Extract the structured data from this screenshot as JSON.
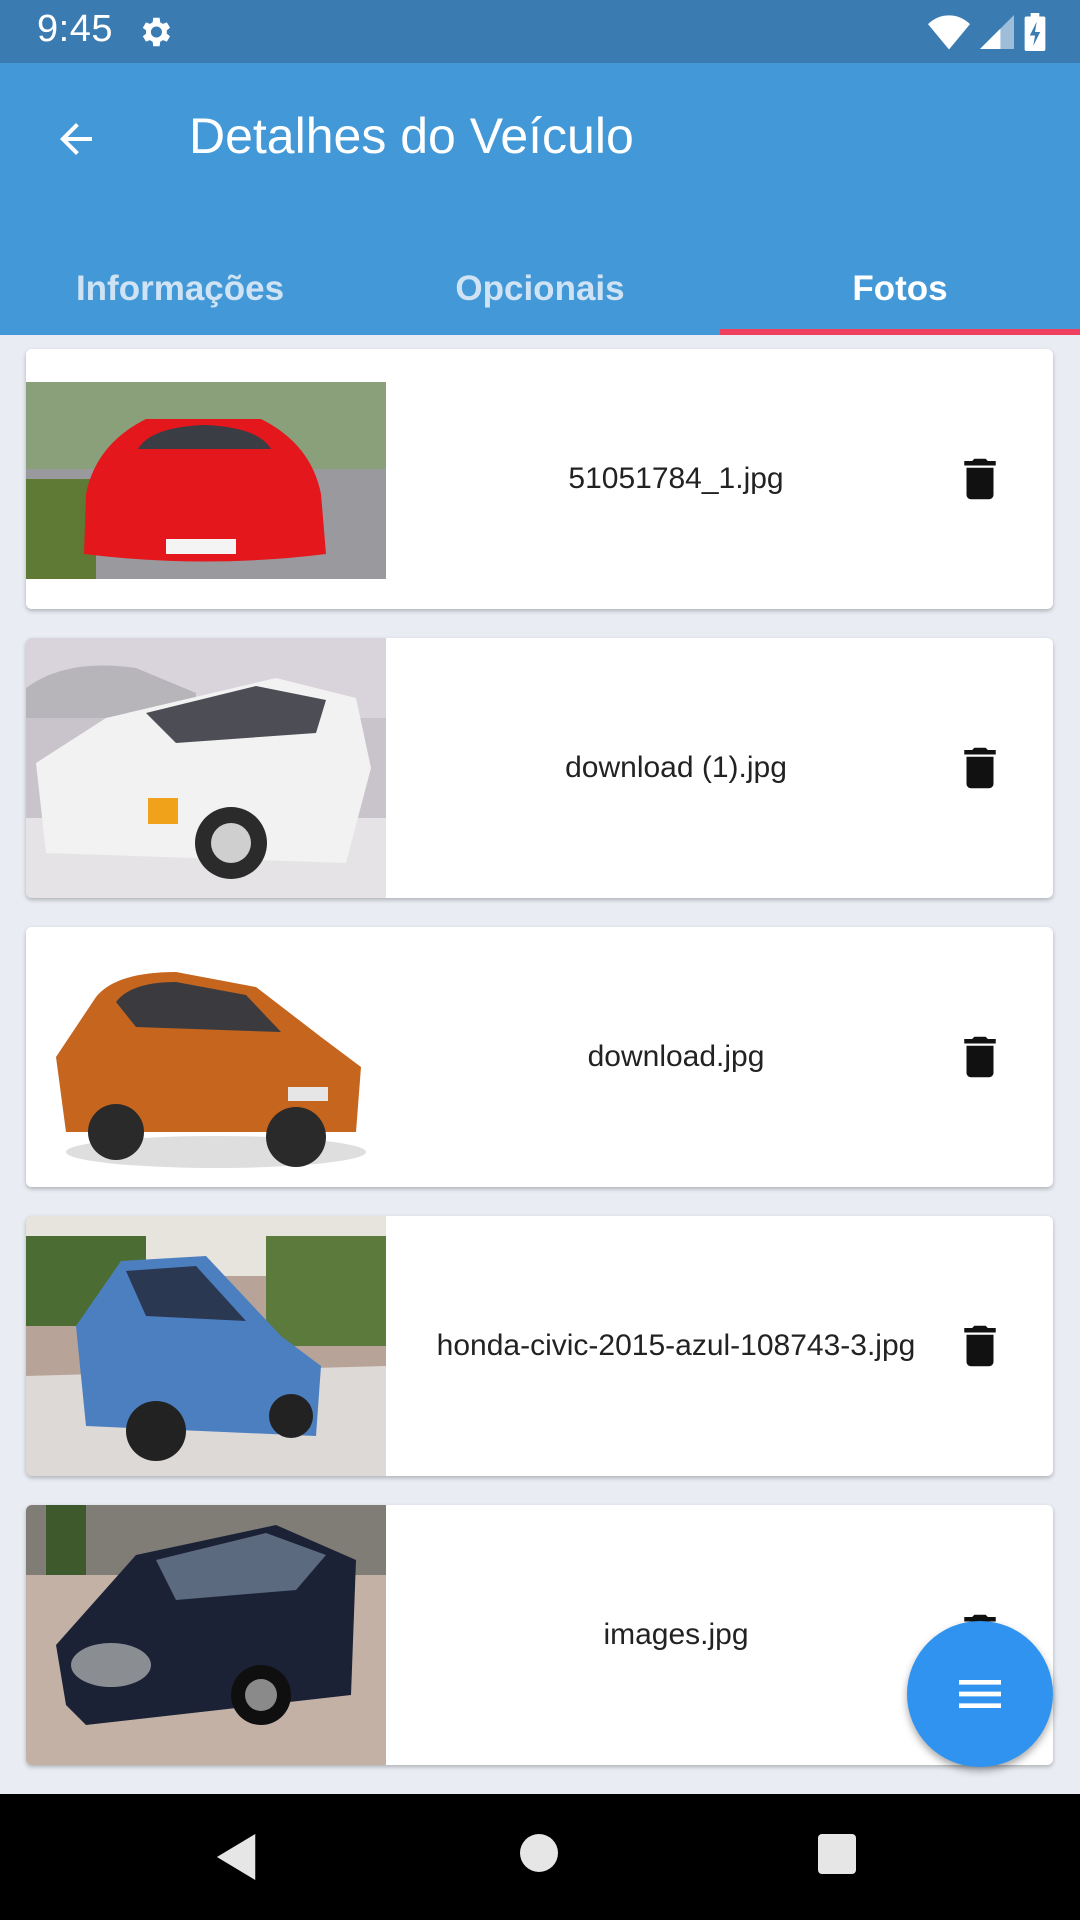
{
  "status_bar": {
    "time": "9:45",
    "icons": [
      "gear-icon",
      "wifi-icon",
      "signal-icon",
      "battery-charging-icon"
    ]
  },
  "app_bar": {
    "title": "Detalhes do Veículo",
    "back_icon": "arrow-back-icon"
  },
  "tabs": [
    {
      "label": "Informações",
      "active": false
    },
    {
      "label": "Opcionais",
      "active": false
    },
    {
      "label": "Fotos",
      "active": true
    }
  ],
  "photos": [
    {
      "filename": "51051784_1.jpg",
      "car_color": "#e3171c"
    },
    {
      "filename": "download (1).jpg",
      "car_color": "#f2f2f2"
    },
    {
      "filename": "download.jpg",
      "car_color": "#c5651e"
    },
    {
      "filename": "honda-civic-2015-azul-108743-3.jpg",
      "car_color": "#4c7fc0"
    },
    {
      "filename": "images.jpg",
      "car_color": "#1b2236"
    }
  ],
  "fab": {
    "icon": "menu-icon"
  },
  "colors": {
    "status_bar": "#3a7bb1",
    "app_bar": "#4399d8",
    "tab_indicator": "#ef3f5e",
    "fab": "#2f93ef"
  }
}
